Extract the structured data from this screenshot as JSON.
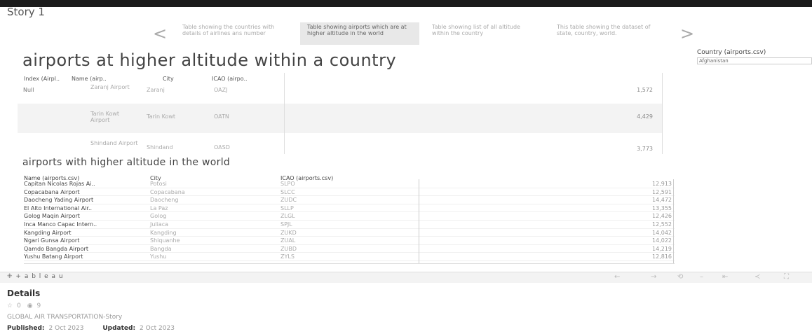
{
  "story": {
    "title": "Story 1"
  },
  "nav": {
    "prev": "<",
    "next": ">"
  },
  "story_points": [
    {
      "label": "Table showing the countries with details of airlines ans number"
    },
    {
      "label": "Table showing airports which are at higher altitude in the world"
    },
    {
      "label": "Table showing list of all altitude within the country"
    },
    {
      "label": "This table showing the dataset of state, country, world."
    }
  ],
  "section1": {
    "title": "airports at higher altitude within a country",
    "headers": [
      "Index (Airpl..",
      "Name (airp..",
      "City",
      "ICAO (airpo.."
    ],
    "index_value": "Null",
    "rows": [
      {
        "name": "Zaranj Airport",
        "city": "Zaranj",
        "icao": "OAZJ",
        "value": "1,572"
      },
      {
        "name": "Tarin Kowt Airport",
        "city": "Tarin Kowt",
        "icao": "OATN",
        "value": "4,429"
      },
      {
        "name": "Shindand Airport",
        "city": "Shindand",
        "icao": "OASD",
        "value": "3,773"
      }
    ]
  },
  "filter": {
    "label": "Country (airports.csv)",
    "value": "Afghanistan"
  },
  "section2": {
    "title": "airports with higher altitude in the world",
    "headers": {
      "name": "Name (airports.csv)",
      "city": "City",
      "icao": "ICAO (airports.csv)"
    },
    "rows": [
      {
        "name": "Capitan Nicolas Rojas Ai..",
        "city": "Potosi",
        "icao": "SLPO",
        "alt": "12,913"
      },
      {
        "name": "Copacabana Airport",
        "city": "Copacabana",
        "icao": "SLCC",
        "alt": "12,591"
      },
      {
        "name": "Daocheng Yading Airport",
        "city": "Daocheng",
        "icao": "ZUDC",
        "alt": "14,472"
      },
      {
        "name": "El Alto International Air..",
        "city": "La Paz",
        "icao": "SLLP",
        "alt": "13,355"
      },
      {
        "name": "Golog Maqin Airport",
        "city": "Golog",
        "icao": "ZLGL",
        "alt": "12,426"
      },
      {
        "name": "Inca Manco Capac Intern..",
        "city": "Juliaca",
        "icao": "SPJL",
        "alt": "12,552"
      },
      {
        "name": "Kangding Airport",
        "city": "Kangding",
        "icao": "ZUKD",
        "alt": "14,042"
      },
      {
        "name": "Ngari Gunsa Airport",
        "city": "Shiquanhe",
        "icao": "ZUAL",
        "alt": "14,022"
      },
      {
        "name": "Qamdo Bangda Airport",
        "city": "Bangda",
        "icao": "ZUBD",
        "alt": "14,219"
      },
      {
        "name": "Yushu Batang Airport",
        "city": "Yushu",
        "icao": "ZYLS",
        "alt": "12,816"
      }
    ]
  },
  "toolbar": {
    "logo": "+ a b l e a u",
    "logo_mark": "⁜",
    "icons": {
      "undo": "←",
      "redo": "→",
      "revert": "⟲",
      "pause": "–",
      "refresh": "⇤",
      "share": "≺",
      "fullscreen": "⛶"
    }
  },
  "details": {
    "title": "Details",
    "favorites": "0",
    "views": "9",
    "star_icon": "☆",
    "eye_icon": "◉",
    "story_name": "GLOBAL AIR TRANSPORTATION-Story",
    "published_label": "Published:",
    "published_date": "2 Oct 2023",
    "updated_label": "Updated:",
    "updated_date": "2 Oct 2023"
  }
}
